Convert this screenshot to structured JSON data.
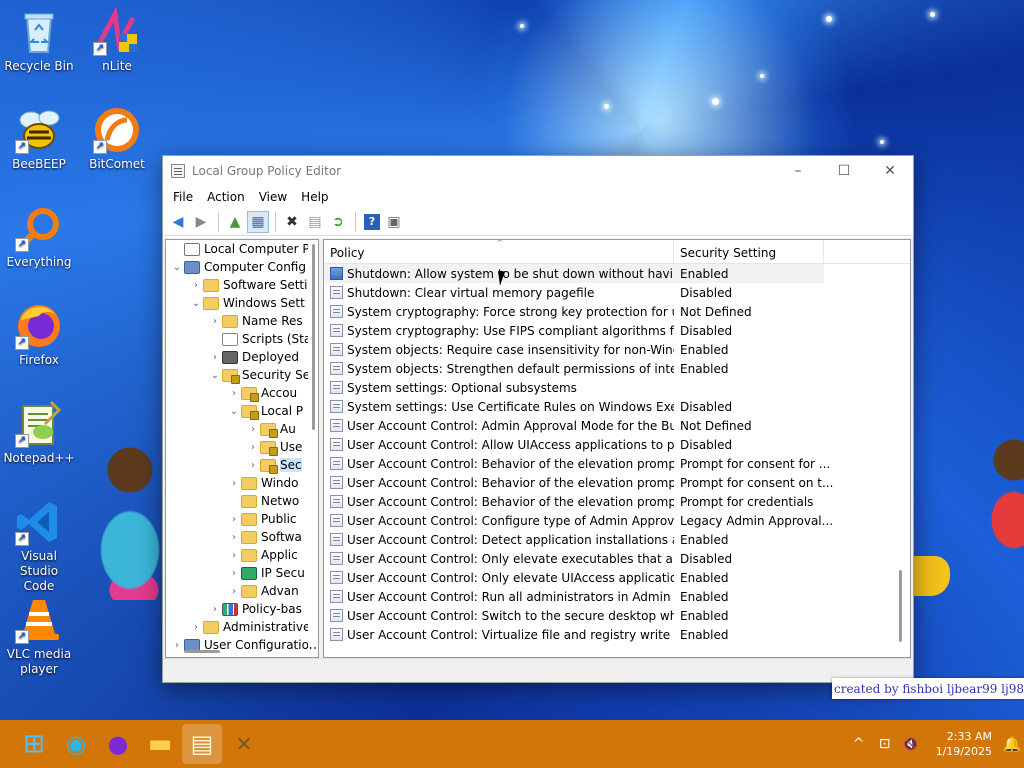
{
  "desktop": {
    "icons": [
      {
        "label": "Recycle Bin",
        "icon": "recycle-bin-icon"
      },
      {
        "label": "nLite",
        "icon": "nlite-icon"
      },
      {
        "label": "BeeBEEP",
        "icon": "beebeep-icon"
      },
      {
        "label": "BitComet",
        "icon": "bitcomet-icon"
      },
      {
        "label": "Everything",
        "icon": "everything-icon"
      },
      {
        "label": "Firefox",
        "icon": "firefox-icon"
      },
      {
        "label": "Notepad++",
        "icon": "notepadpp-icon"
      },
      {
        "label": "Visual Studio Code",
        "icon": "vscode-icon"
      },
      {
        "label": "VLC media player",
        "icon": "vlc-icon"
      }
    ],
    "credit_text": "created by fishboi ljbear99 lj98",
    "accent_colors": {
      "taskbar": "#d3760a",
      "wallpaper": "#1a5ad8"
    }
  },
  "window": {
    "title": "Local Group Policy Editor",
    "controls": {
      "minimize": "–",
      "maximize": "☐",
      "close": "✕"
    },
    "menu": [
      "File",
      "Action",
      "View",
      "Help"
    ],
    "toolbar": [
      {
        "name": "back-icon",
        "glyph": "◀"
      },
      {
        "name": "forward-icon",
        "glyph": "▶"
      },
      {
        "name": "up-folder-icon",
        "glyph": "▲"
      },
      {
        "name": "show-tree-icon",
        "glyph": "▦"
      },
      {
        "name": "delete-icon",
        "glyph": "✖"
      },
      {
        "name": "properties-icon",
        "glyph": "▤"
      },
      {
        "name": "export-icon",
        "glyph": "➲"
      },
      {
        "name": "help-icon",
        "glyph": "?"
      },
      {
        "name": "console-icon",
        "glyph": "▣"
      }
    ],
    "tree": [
      {
        "label": "Local Computer Polic",
        "indent": 0,
        "arrow": "",
        "icon": "doc"
      },
      {
        "label": "Computer Config",
        "indent": 0,
        "arrow": "⌄",
        "icon": "comp"
      },
      {
        "label": "Software Setti",
        "indent": 1,
        "arrow": "›",
        "icon": ""
      },
      {
        "label": "Windows Sett",
        "indent": 1,
        "arrow": "⌄",
        "icon": ""
      },
      {
        "label": "Name Res",
        "indent": 2,
        "arrow": "›",
        "icon": ""
      },
      {
        "label": "Scripts (Sta",
        "indent": 2,
        "arrow": "",
        "icon": "script"
      },
      {
        "label": "Deployed",
        "indent": 2,
        "arrow": "›",
        "icon": "deploy"
      },
      {
        "label": "Security Se",
        "indent": 2,
        "arrow": "⌄",
        "icon": "lock"
      },
      {
        "label": "Accou",
        "indent": 3,
        "arrow": "›",
        "icon": "lock"
      },
      {
        "label": "Local P",
        "indent": 3,
        "arrow": "⌄",
        "icon": "lock"
      },
      {
        "label": "Au",
        "indent": 4,
        "arrow": "›",
        "icon": "lock"
      },
      {
        "label": "Use",
        "indent": 4,
        "arrow": "›",
        "icon": "lock"
      },
      {
        "label": "Sec",
        "indent": 4,
        "arrow": "›",
        "icon": "lock",
        "selected": true
      },
      {
        "label": "Windo",
        "indent": 3,
        "arrow": "›",
        "icon": ""
      },
      {
        "label": "Netwo",
        "indent": 3,
        "arrow": "",
        "icon": ""
      },
      {
        "label": "Public",
        "indent": 3,
        "arrow": "›",
        "icon": ""
      },
      {
        "label": "Softwa",
        "indent": 3,
        "arrow": "›",
        "icon": ""
      },
      {
        "label": "Applic",
        "indent": 3,
        "arrow": "›",
        "icon": ""
      },
      {
        "label": "IP Secu",
        "indent": 3,
        "arrow": "›",
        "icon": "ipsec"
      },
      {
        "label": "Advan",
        "indent": 3,
        "arrow": "›",
        "icon": ""
      },
      {
        "label": "Policy-bas",
        "indent": 2,
        "arrow": "›",
        "icon": "chart"
      },
      {
        "label": "Administrative",
        "indent": 1,
        "arrow": "›",
        "icon": ""
      },
      {
        "label": "User Configuration",
        "indent": 0,
        "arrow": "›",
        "icon": "comp"
      }
    ],
    "columns": {
      "policy": "Policy",
      "setting": "Security Setting"
    },
    "policies": [
      {
        "policy": "Shutdown: Allow system to be shut down without having to...",
        "setting": "Enabled",
        "blue": true
      },
      {
        "policy": "Shutdown: Clear virtual memory pagefile",
        "setting": "Disabled"
      },
      {
        "policy": "System cryptography: Force strong key protection for user k...",
        "setting": "Not Defined"
      },
      {
        "policy": "System cryptography: Use FIPS compliant algorithms for en...",
        "setting": "Disabled"
      },
      {
        "policy": "System objects: Require case insensitivity for non-Windows ...",
        "setting": "Enabled"
      },
      {
        "policy": "System objects: Strengthen default permissions of internal s...",
        "setting": "Enabled"
      },
      {
        "policy": "System settings: Optional subsystems",
        "setting": ""
      },
      {
        "policy": "System settings: Use Certificate Rules on Windows Executabl...",
        "setting": "Disabled"
      },
      {
        "policy": "User Account Control: Admin Approval Mode for the Built-i...",
        "setting": "Not Defined"
      },
      {
        "policy": "User Account Control: Allow UIAccess applications to prom...",
        "setting": "Disabled"
      },
      {
        "policy": "User Account Control: Behavior of the elevation prompt for ...",
        "setting": "Prompt for consent for ..."
      },
      {
        "policy": "User Account Control: Behavior of the elevation prompt for ...",
        "setting": "Prompt for consent on t..."
      },
      {
        "policy": "User Account Control: Behavior of the elevation prompt for ...",
        "setting": "Prompt for credentials"
      },
      {
        "policy": "User Account Control: Configure type of Admin Approval M...",
        "setting": "Legacy Admin Approval..."
      },
      {
        "policy": "User Account Control: Detect application installations and p...",
        "setting": "Enabled"
      },
      {
        "policy": "User Account Control: Only elevate executables that are sign...",
        "setting": "Disabled"
      },
      {
        "policy": "User Account Control: Only elevate UIAccess applications th...",
        "setting": "Enabled"
      },
      {
        "policy": "User Account Control: Run all administrators in Admin Appr...",
        "setting": "Enabled"
      },
      {
        "policy": "User Account Control: Switch to the secure desktop when pr...",
        "setting": "Enabled"
      },
      {
        "policy": "User Account Control: Virtualize file and registry write failure...",
        "setting": "Enabled"
      }
    ]
  },
  "taskbar": {
    "apps": [
      {
        "name": "start-button",
        "glyph": "⊞"
      },
      {
        "name": "edge-icon",
        "glyph": "◉"
      },
      {
        "name": "firefox-taskbar-icon",
        "glyph": "●"
      },
      {
        "name": "file-explorer-icon",
        "glyph": "▬"
      },
      {
        "name": "notepad-taskbar-icon",
        "glyph": "▤",
        "active": true
      },
      {
        "name": "nlite-taskbar-icon",
        "glyph": "✕"
      }
    ],
    "tray": {
      "chevron": "^",
      "network": "⊡",
      "volume": "🔇",
      "bell": "🔔"
    },
    "time": "2:33 AM",
    "date": "1/19/2025"
  }
}
